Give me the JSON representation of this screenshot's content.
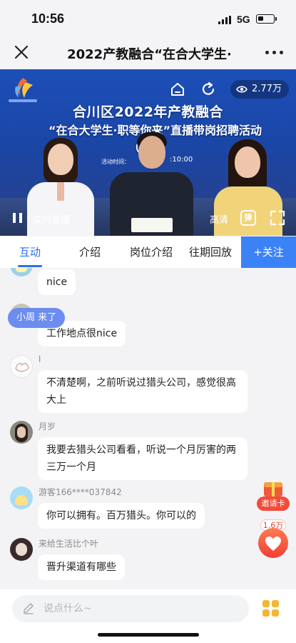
{
  "status_bar": {
    "time": "10:56",
    "network": "5G",
    "battery_level": 0.35
  },
  "nav": {
    "title": "2022产教融合“在合大学生·",
    "close_icon": "close-icon",
    "more_icon": "more-dots-icon"
  },
  "video": {
    "viewers": "2.77万",
    "title_line1": "合川区2022年产教融合",
    "title_line2": "“在合大学生·职等你来”直播带岗招聘活动",
    "title_line3": "（第",
    "time_label": "活动时间：",
    "time_value": ":10:00",
    "live_label": "实时直播",
    "quality_label": "高清",
    "danmu_label": "弹"
  },
  "tabs": {
    "items": [
      {
        "label": "互动",
        "active": true
      },
      {
        "label": "介绍",
        "active": false
      },
      {
        "label": "岗位介绍",
        "active": false
      },
      {
        "label": "往期回放",
        "active": false
      }
    ],
    "follow_label": "+关注"
  },
  "chat": {
    "join_notice": "小周 来了",
    "messages": [
      {
        "user": "",
        "text": "nice"
      },
      {
        "user": "",
        "text": "工作地点很nice"
      },
      {
        "user": "l",
        "text": "不清楚啊，之前听说过猎头公司，感觉很高大上"
      },
      {
        "user": "月岁",
        "text": "我要去猎头公司看看，听说一个月厉害的两三万一个月"
      },
      {
        "user": "游客166****037842",
        "text": "你可以拥有。百万猎头。你可以的"
      },
      {
        "user": "来给生活比个叶",
        "text": "晋升渠道有哪些"
      }
    ]
  },
  "side": {
    "invite_label": "邀请卡",
    "like_count": "1.6万"
  },
  "input": {
    "placeholder": "说点什么~"
  },
  "colors": {
    "accent": "#2a6df4",
    "follow_bg": "#3b82f6",
    "join_banner": "#6b8df0",
    "like": "#f0442f",
    "grid": "#f2b733"
  }
}
